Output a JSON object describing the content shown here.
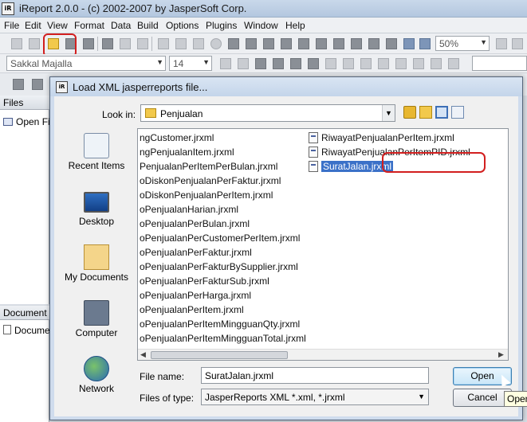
{
  "app": {
    "title": "iReport 2.0.0  -  (c) 2002-2007 by JasperSoft Corp.",
    "icon_text": "iR",
    "menu": [
      "File",
      "Edit",
      "View",
      "Format",
      "Data",
      "Build",
      "Options",
      "Plugins",
      "Window",
      "Help"
    ],
    "zoom": "50%",
    "font_name": "Sakkal Majalla",
    "font_size": "14",
    "files_panel_title": "Files",
    "files_item": "Open Files",
    "document_panel_title": "Document structure",
    "document_item": "Document"
  },
  "dialog": {
    "title": "Load XML jasperreports file...",
    "look_in_label": "Look in:",
    "look_in_value": "Penjualan",
    "places": [
      {
        "label": "Recent Items",
        "icon": "recent-items-icon"
      },
      {
        "label": "Desktop",
        "icon": "desktop-icon"
      },
      {
        "label": "My Documents",
        "icon": "my-documents-icon"
      },
      {
        "label": "Computer",
        "icon": "computer-icon"
      },
      {
        "label": "Network",
        "icon": "network-icon"
      }
    ],
    "files_col1": [
      "ngCustomer.jrxml",
      "ngPenjualanItem.jrxml",
      "PenjualanPerItemPerBulan.jrxml",
      "oDiskonPenjualanPerFaktur.jrxml",
      "oDiskonPenjualanPerItem.jrxml",
      "oPenjualanHarian.jrxml",
      "oPenjualanPerBulan.jrxml",
      "oPenjualanPerCustomerPerItem.jrxml",
      "oPenjualanPerFaktur.jrxml",
      "oPenjualanPerFakturBySupplier.jrxml",
      "oPenjualanPerFakturSub.jrxml",
      "oPenjualanPerHarga.jrxml",
      "oPenjualanPerItem.jrxml",
      "oPenjualanPerItemMingguanQty.jrxml",
      "oPenjualanPerItemMingguanTotal.jrxml"
    ],
    "files_col2": [
      "RiwayatPenjualanPerItem.jrxml",
      "RiwayatPenjualanPerItemPID.jrxml",
      "SuratJalan.jrxml"
    ],
    "selected_file": "SuratJalan.jrxml",
    "file_name_label": "File name:",
    "file_name_value": "SuratJalan.jrxml",
    "files_of_type_label": "Files of type:",
    "files_of_type_value": "JasperReports XML *.xml, *.jrxml",
    "open_button": "Open",
    "cancel_button": "Cancel",
    "tooltip": "Open"
  }
}
